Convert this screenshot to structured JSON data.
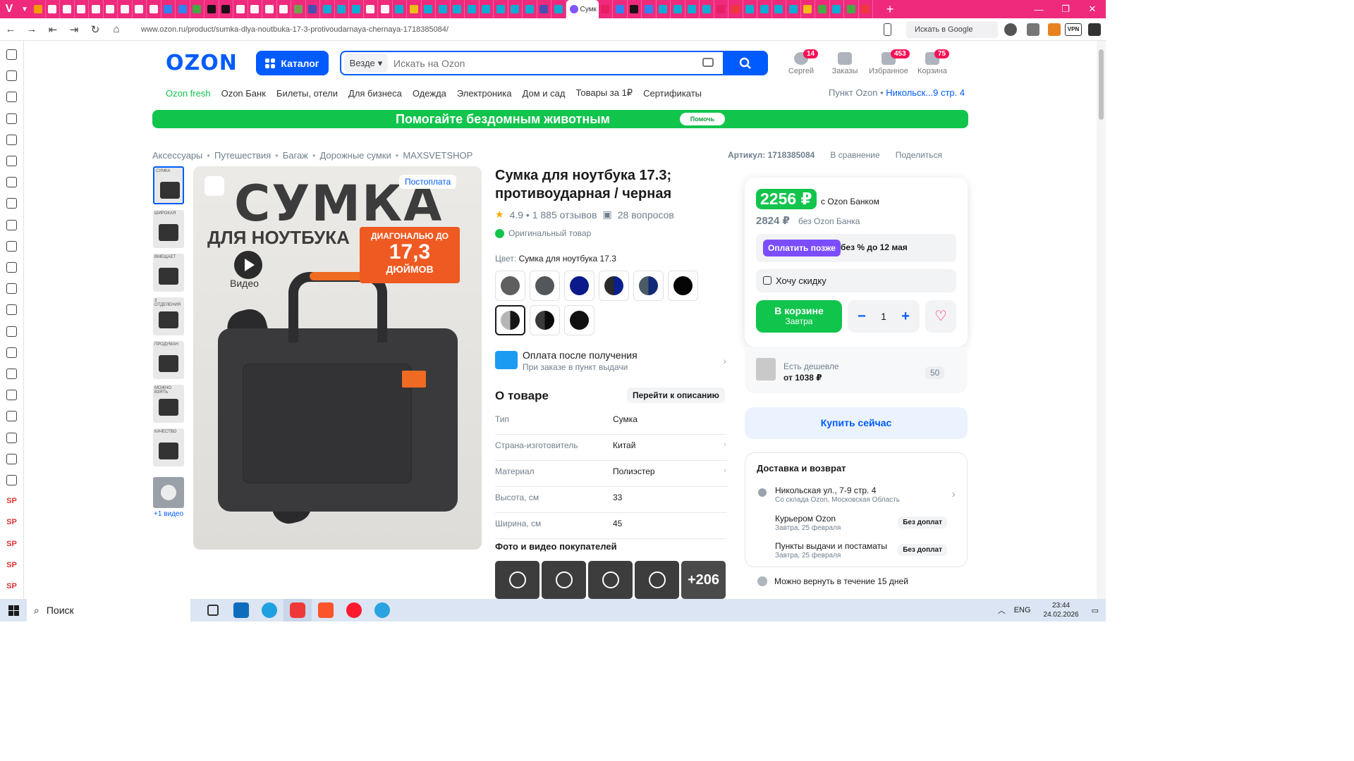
{
  "browser": {
    "active_tab_label": "Сумк",
    "url": "www.ozon.ru/product/sumka-dlya-noutbuka-17-3-protivoudarnaya-chernaya-1718385084/",
    "search_google": "Искать в Google",
    "vpn": "VPN"
  },
  "header": {
    "logo": "OZON",
    "catalog": "Каталог",
    "search_scope": "Везде",
    "search_placeholder": "Искать на Ozon",
    "user": {
      "label": "Сергей",
      "badge": "14"
    },
    "orders": {
      "label": "Заказы"
    },
    "favorites": {
      "label": "Избранное",
      "badge": "453"
    },
    "cart": {
      "label": "Корзина",
      "badge": "75"
    }
  },
  "nav": {
    "items": [
      "Ozon fresh",
      "Ozon Банк",
      "Билеты, отели",
      "Для бизнеса",
      "Одежда",
      "Электроника",
      "Дом и сад",
      "Товары за 1₽",
      "Сертификаты"
    ],
    "pickup_label": "Пункт Ozon •",
    "pickup_address": "Никольск...9 стр. 4"
  },
  "banner": {
    "text": "Помогайте бездомным животным",
    "button": "Помочь"
  },
  "breadcrumbs": [
    "Аксессуары",
    "Путешествия",
    "Багаж",
    "Дорожные сумки",
    "MAXSVETSHOP"
  ],
  "meta": {
    "article": "Артикул: 1718385084",
    "compare": "В сравнение",
    "share": "Поделиться"
  },
  "gallery": {
    "thumb_captions": [
      "СУМКА",
      "ШИРОКАЯ",
      "ВМЕЩАЕТ",
      "3 ОТДЕЛЕНИЯ",
      "ПРОДУМАН",
      "МОЖНО ВЗЯТЬ",
      "КАЧЕСТВО"
    ],
    "more_video": "+1 видео",
    "image_title": "СУМКА",
    "image_subtitle": "ДЛЯ НОУТБУКА",
    "diag_line1": "ДИАГОНАЛЬЮ ДО",
    "diag_line2": "17,3",
    "diag_line3": "ДЮЙМОВ",
    "video_label": "Видео",
    "postpay": "Постоплата"
  },
  "product": {
    "title": "Сумка для ноутбука 17.3; противоударная / черная",
    "rating": "4.9 • 1 885 отзывов",
    "questions": "28 вопросов",
    "original": "Оригинальный товар",
    "color_label": "Цвет:",
    "color_value": "Сумка для ноутбука 17.3",
    "swatches": [
      {
        "color": "#5f5f5f"
      },
      {
        "color": "#53575c"
      },
      {
        "color": "#0a1a8a"
      },
      {
        "color": "#0c1f8e",
        "half": "#2a2a2a"
      },
      {
        "color": "#102a78",
        "half": "#4a5a66"
      },
      {
        "color": "#050505"
      },
      {
        "color": "#151515",
        "half": "#b5b5b5"
      },
      {
        "color": "#0a0a0a",
        "half": "#3a3a3a"
      },
      {
        "color": "#111111"
      }
    ],
    "pay_after_title": "Оплата после получения",
    "pay_after_sub": "При заказе в пункт выдачи",
    "about": "О товаре",
    "go_to_description": "Перейти к описанию",
    "specs": [
      {
        "k": "Тип",
        "v": "Сумка"
      },
      {
        "k": "Страна-изготовитель",
        "v": "Китай"
      },
      {
        "k": "Материал",
        "v": "Полиэстер"
      },
      {
        "k": "Высота, см",
        "v": "33"
      },
      {
        "k": "Ширина, см",
        "v": "45"
      }
    ],
    "photos_title": "Фото и видео покупателей",
    "photos_more": "+206"
  },
  "buy": {
    "price_bank": "2256 ₽",
    "price_bank_label": "с Ozon Банком",
    "price": "2824 ₽",
    "price_label": "без Ozon Банка",
    "pay_later_btn": "Оплатить позже",
    "pay_later_text": "без % до 12 мая",
    "want_discount": "Хочу скидку",
    "cart_btn": "В корзине",
    "cart_sub": "Завтра",
    "qty": "1",
    "cheaper_label": "Есть дешевле",
    "cheaper_price": "от 1038 ₽",
    "cheaper_count": "50",
    "buy_now": "Купить сейчас"
  },
  "delivery": {
    "title": "Доставка и возврат",
    "address": "Никольская ул., 7-9 стр. 4",
    "address_sub": "Со склада Ozon, Московская Область",
    "courier": "Курьером Ozon",
    "courier_date": "Завтра, 25 февраля",
    "courier_tag": "Без доплат",
    "pickup": "Пункты выдачи и постаматы",
    "pickup_date": "Завтра, 25 февраля",
    "pickup_tag": "Без доплат",
    "returns": "Можно вернуть в течение 15 дней"
  },
  "taskbar": {
    "search": "Поиск",
    "lang": "ENG",
    "time": "23:44",
    "date": "24.02.2026"
  }
}
